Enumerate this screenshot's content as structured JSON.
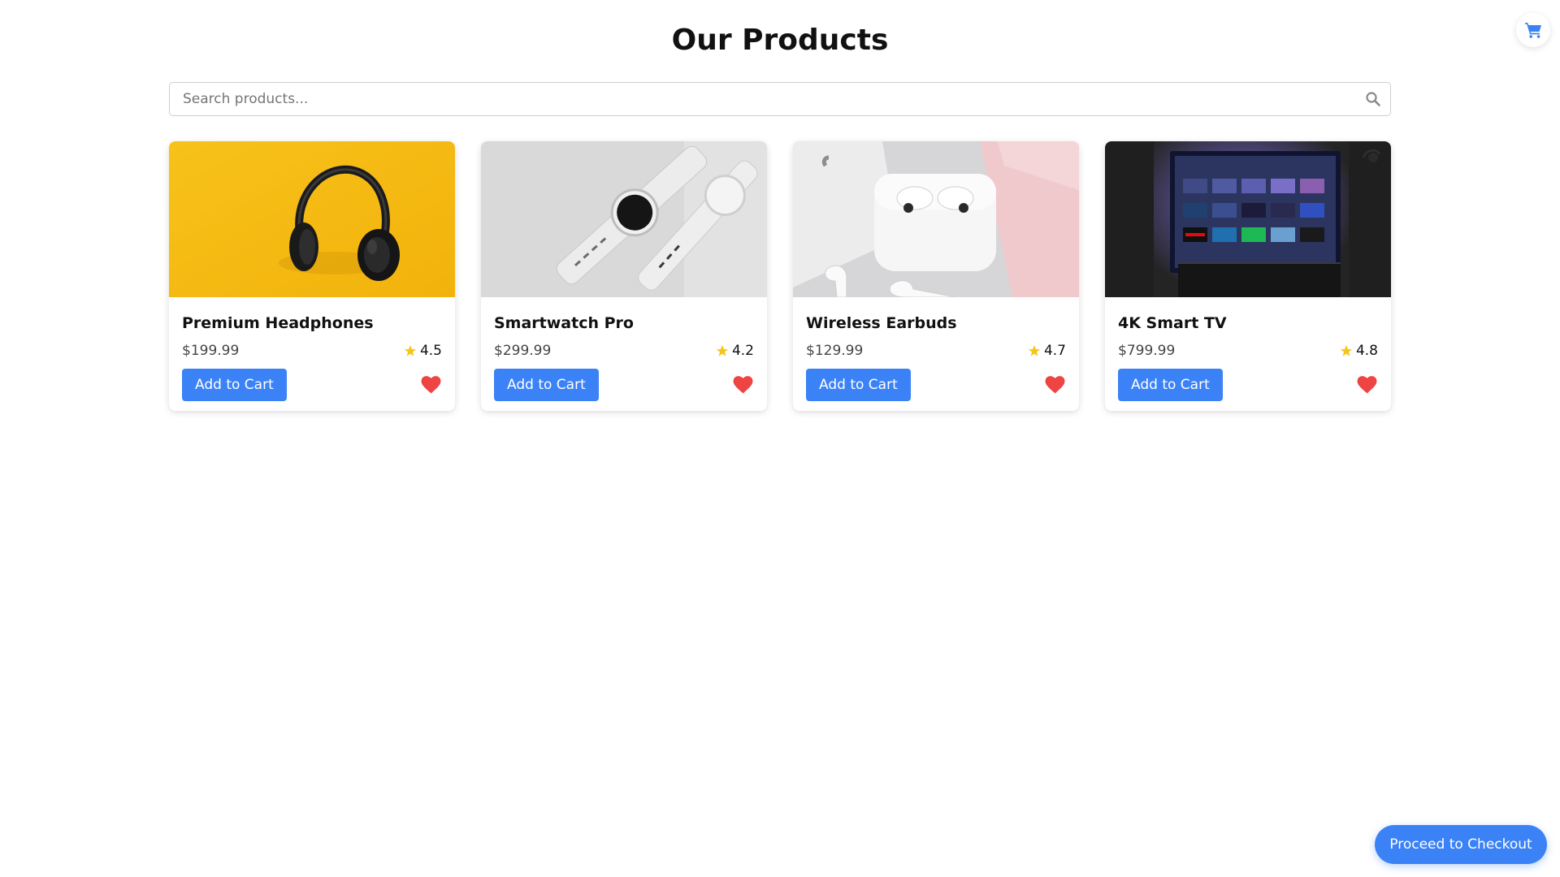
{
  "header": {
    "title": "Our Products"
  },
  "search": {
    "placeholder": "Search products...",
    "value": ""
  },
  "products": [
    {
      "name": "Premium Headphones",
      "price": "$199.99",
      "rating": "4.5",
      "button_label": "Add to Cart",
      "image_icon": "headphones-photo"
    },
    {
      "name": "Smartwatch Pro",
      "price": "$299.99",
      "rating": "4.2",
      "button_label": "Add to Cart",
      "image_icon": "smartwatch-photo"
    },
    {
      "name": "Wireless Earbuds",
      "price": "$129.99",
      "rating": "4.7",
      "button_label": "Add to Cart",
      "image_icon": "earbuds-photo"
    },
    {
      "name": "4K Smart TV",
      "price": "$799.99",
      "rating": "4.8",
      "button_label": "Add to Cart",
      "image_icon": "smart-tv-photo"
    }
  ],
  "checkout": {
    "label": "Proceed to Checkout"
  },
  "colors": {
    "accent": "#3b82f6",
    "star": "#f5c518",
    "heart": "#ef4444"
  }
}
